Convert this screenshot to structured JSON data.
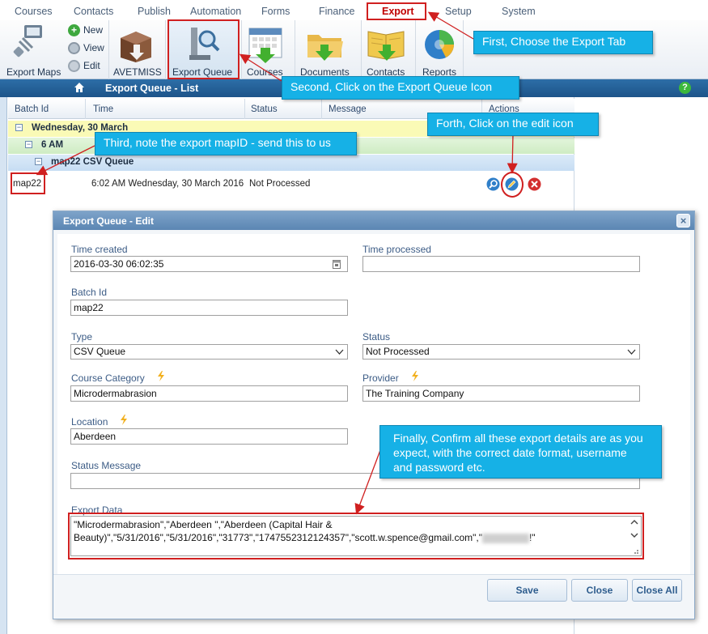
{
  "menu": {
    "items": [
      "Courses",
      "Contacts",
      "Publish",
      "Automation",
      "Forms",
      "Finance",
      "Export",
      "Setup",
      "System"
    ],
    "active": "Export"
  },
  "ribbon": {
    "export_maps": "Export Maps",
    "new": "New",
    "view": "View",
    "edit": "Edit",
    "avetmiss": "AVETMISS",
    "export_queue": "Export Queue",
    "courses": "Courses",
    "documents": "Documents",
    "contacts": "Contacts",
    "reports": "Reports"
  },
  "titlebar": {
    "title": "Export Queue - List",
    "help": "?"
  },
  "grid": {
    "columns": [
      "Batch Id",
      "Time",
      "Status",
      "Message",
      "Actions"
    ],
    "group_date": "Wednesday, 30 March",
    "group_hour": "6 AM",
    "group_queue": "map22 CSV Queue",
    "row": {
      "batch_id": "map22",
      "time": "6:02 AM Wednesday, 30 March 2016",
      "status": "Not Processed"
    }
  },
  "callouts": {
    "first": "First, Choose the Export Tab",
    "second": "Second, Click on the Export Queue Icon",
    "third": "Third, note the export mapID - send this to us",
    "fourth": "Forth, Click on the edit icon",
    "finally": "Finally, Confirm all these export details are as you expect, with the correct date format, username and password etc."
  },
  "dialog": {
    "title": "Export Queue - Edit",
    "close_x": "×",
    "time_created_label": "Time created",
    "time_created": "2016-03-30 06:02:35",
    "time_processed_label": "Time processed",
    "time_processed": "",
    "batch_id_label": "Batch Id",
    "batch_id": "map22",
    "type_label": "Type",
    "type": "CSV Queue",
    "status_label": "Status",
    "status": "Not Processed",
    "course_category_label": "Course Category",
    "course_category": "Microdermabrasion",
    "provider_label": "Provider",
    "provider": "The Training Company",
    "location_label": "Location",
    "location": "Aberdeen",
    "status_message_label": "Status Message",
    "status_message": "",
    "export_data_label": "Export Data",
    "export_data": "\"Microdermabrasion\",\"Aberdeen \",\"Aberdeen (Capital Hair & Beauty)\",\"5/31/2016\",\"5/31/2016\",\"31773\",\"1747552312124357\",\"scott.w.spence@gmail.com\",\"",
    "export_data_tail": "!\"",
    "save": "Save",
    "close": "Close",
    "close_all": "Close All"
  },
  "colors": {
    "callout": "#16b1e6",
    "highlight_red": "#d02020",
    "titlebar_blue": "#1d5489"
  }
}
